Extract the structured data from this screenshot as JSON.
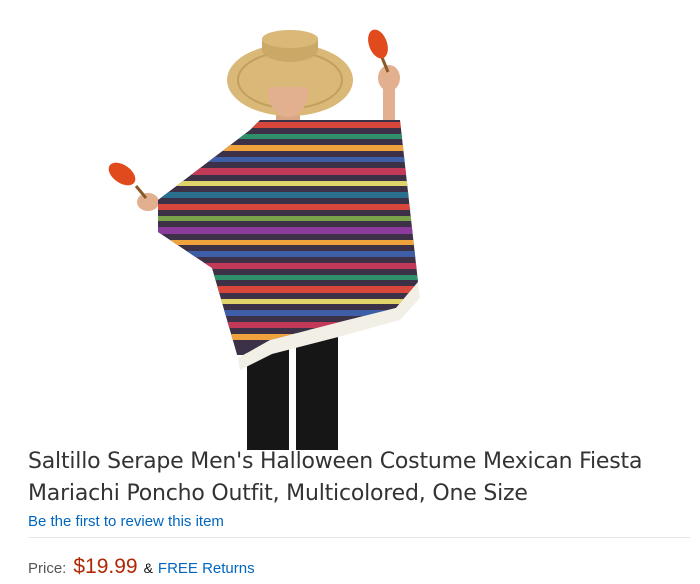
{
  "product": {
    "title_line1": "Saltillo Serape Men's Halloween Costume Mexican Fiesta",
    "title_line2": "Mariachi Poncho Outfit, Multicolored, One Size",
    "review_link": "Be the first to review this item"
  },
  "pricing": {
    "label": "Price:",
    "value": "$19.99",
    "ampersand": "&",
    "returns": "FREE Returns"
  },
  "colors": {
    "price": "#b12704",
    "link": "#0066c0",
    "title": "#333333"
  }
}
